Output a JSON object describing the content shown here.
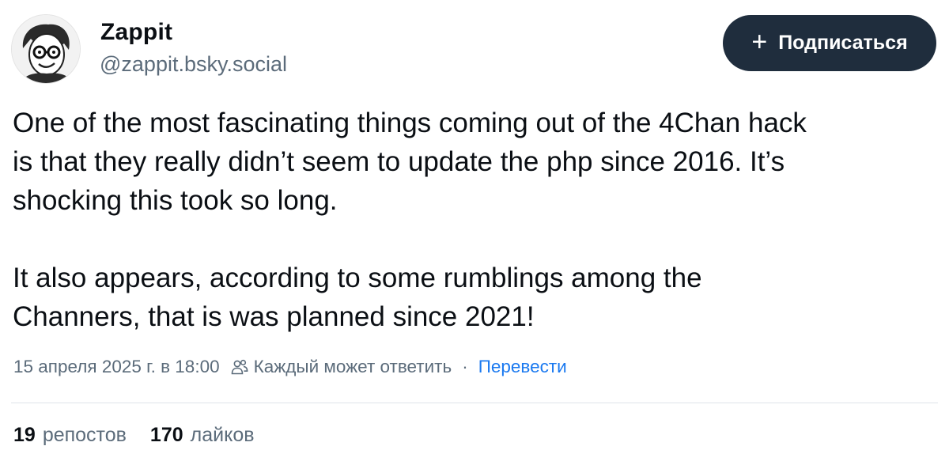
{
  "author": {
    "display_name": "Zappit",
    "handle": "@zappit.bsky.social",
    "avatar_icon": "avatar-cartoon-glasses-icon"
  },
  "follow_button": {
    "icon": "plus-icon",
    "label": "Подписаться"
  },
  "post": {
    "paragraph1": [
      "One of the most fascinating things coming out of the 4Chan hack",
      "is that they really didn’t seem to update the php since 2016. It’s",
      "shocking this took so long."
    ],
    "paragraph2": [
      "It also appears, according to some rumblings among the",
      "Channers, that is was planned since 2021!"
    ]
  },
  "meta": {
    "timestamp": "15 апреля 2025 г. в 18:00",
    "reply_setting_icon": "people-icon",
    "reply_setting": "Каждый может ответить",
    "separator": "·",
    "translate_label": "Перевести"
  },
  "stats": {
    "reposts_count": "19",
    "reposts_label": "репостов",
    "likes_count": "170",
    "likes_label": "лайков"
  },
  "colors": {
    "text": "#0b0f14",
    "muted": "#5b6b7a",
    "link": "#1a79f0",
    "button_bg": "#1f2d3d",
    "divider": "#dfe4ea"
  }
}
